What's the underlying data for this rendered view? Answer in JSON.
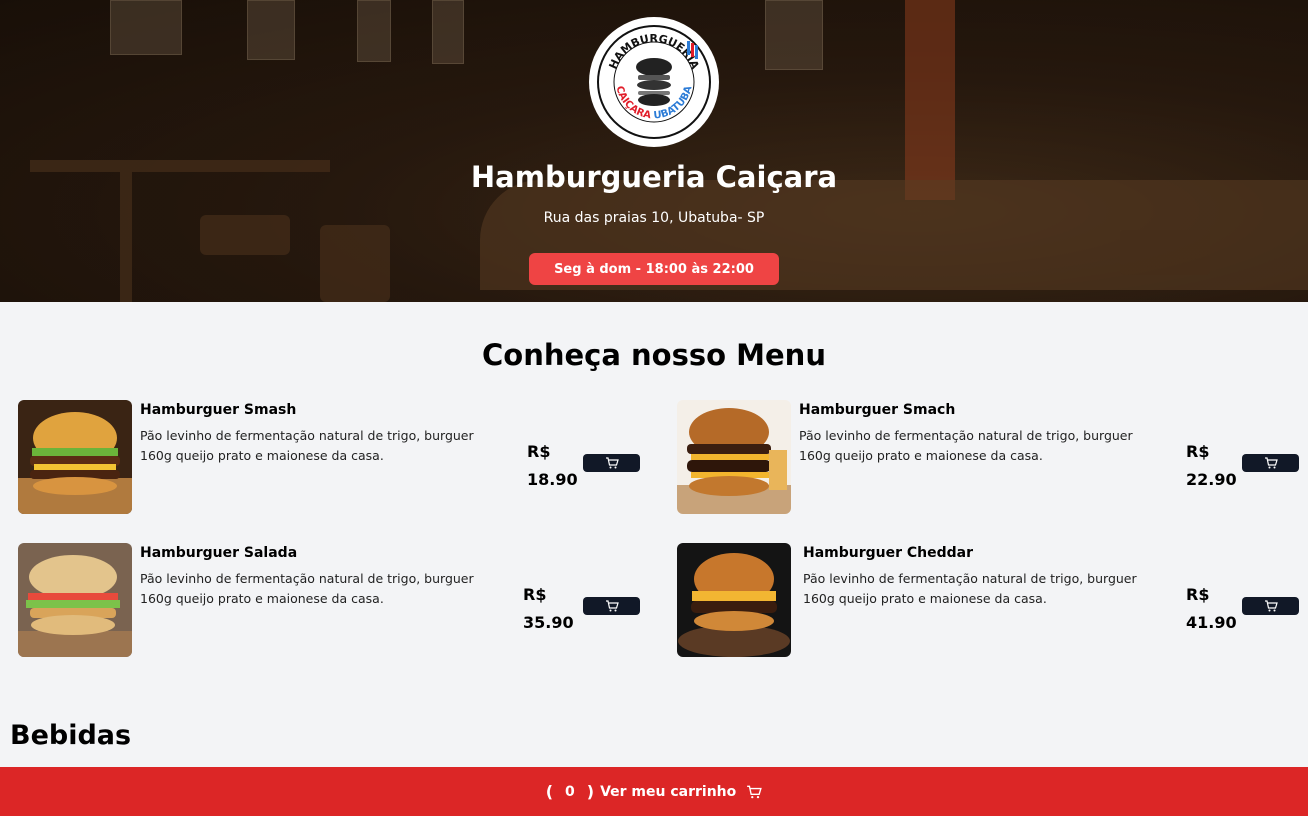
{
  "header": {
    "logo_top_text": "HAMBURGUERIA",
    "logo_bottom_text_1": "CAIÇARA",
    "logo_bottom_text_2": "UBATUBA",
    "title": "Hamburgueria Caiçara",
    "address": "Rua das praias 10, Ubatuba- SP",
    "hours": "Seg à dom - 18:00 às 22:00",
    "hours_color": "#ef4444"
  },
  "menu": {
    "title": "Conheça nosso Menu",
    "items": [
      {
        "name": "Hamburguer Smash",
        "description": "Pão levinho de fermentação natural de trigo, burguer 160g queijo prato e maionese da casa.",
        "currency": "R$",
        "price": "18.90"
      },
      {
        "name": "Hamburguer Smach",
        "description": "Pão levinho de fermentação natural de trigo, burguer 160g queijo prato e maionese da casa.",
        "currency": "R$",
        "price": "22.90"
      },
      {
        "name": "Hamburguer Salada",
        "description": "Pão levinho de fermentação natural de trigo, burguer 160g queijo prato e maionese da casa.",
        "currency": "R$",
        "price": "35.90"
      },
      {
        "name": "Hamburguer Cheddar",
        "description": "Pão levinho de fermentação natural de trigo, burguer 160g queijo prato e maionese da casa.",
        "currency": "R$",
        "price": "41.90"
      }
    ],
    "cart_button_icon": "cart-icon"
  },
  "sections": {
    "drinks_title": "Bebidas"
  },
  "footer": {
    "open_paren": "(",
    "cart_count": "0",
    "close_paren": ")",
    "cart_label": "Ver meu carrinho",
    "icon": "cart-icon",
    "color": "#dc2626"
  }
}
